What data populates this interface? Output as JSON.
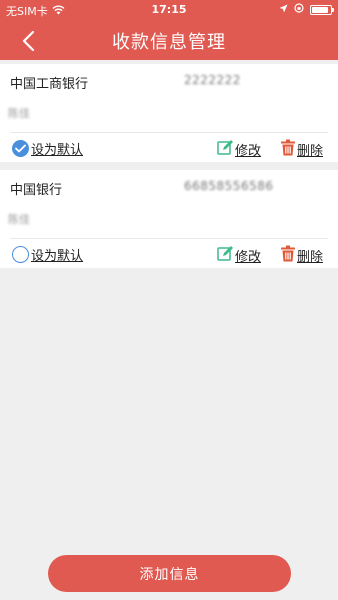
{
  "status_bar": {
    "carrier": "无SIM卡",
    "time": "17:15",
    "wifi_icon": "wifi-icon",
    "location_icon": "location-arrow-icon",
    "lock_icon": "rotation-lock-icon",
    "battery_icon": "battery-icon"
  },
  "header": {
    "title": "收款信息管理",
    "back_icon": "chevron-left-icon",
    "background_color": "#e05a52"
  },
  "accounts": [
    {
      "bank": "中国工商银行",
      "card_number": "2222222",
      "holder": "陈佳",
      "is_default": true,
      "set_default_label": "设为默认",
      "edit_label": "修改",
      "delete_label": "删除"
    },
    {
      "bank": "中国银行",
      "card_number": "66858556586",
      "holder": "陈佳",
      "is_default": false,
      "set_default_label": "设为默认",
      "edit_label": "修改",
      "delete_label": "删除"
    }
  ],
  "footer": {
    "add_label": "添加信息"
  },
  "colors": {
    "accent": "#e05a52",
    "check": "#4a8fdc",
    "edit_icon": "#3dbb8a",
    "delete_icon": "#e05a3a"
  }
}
